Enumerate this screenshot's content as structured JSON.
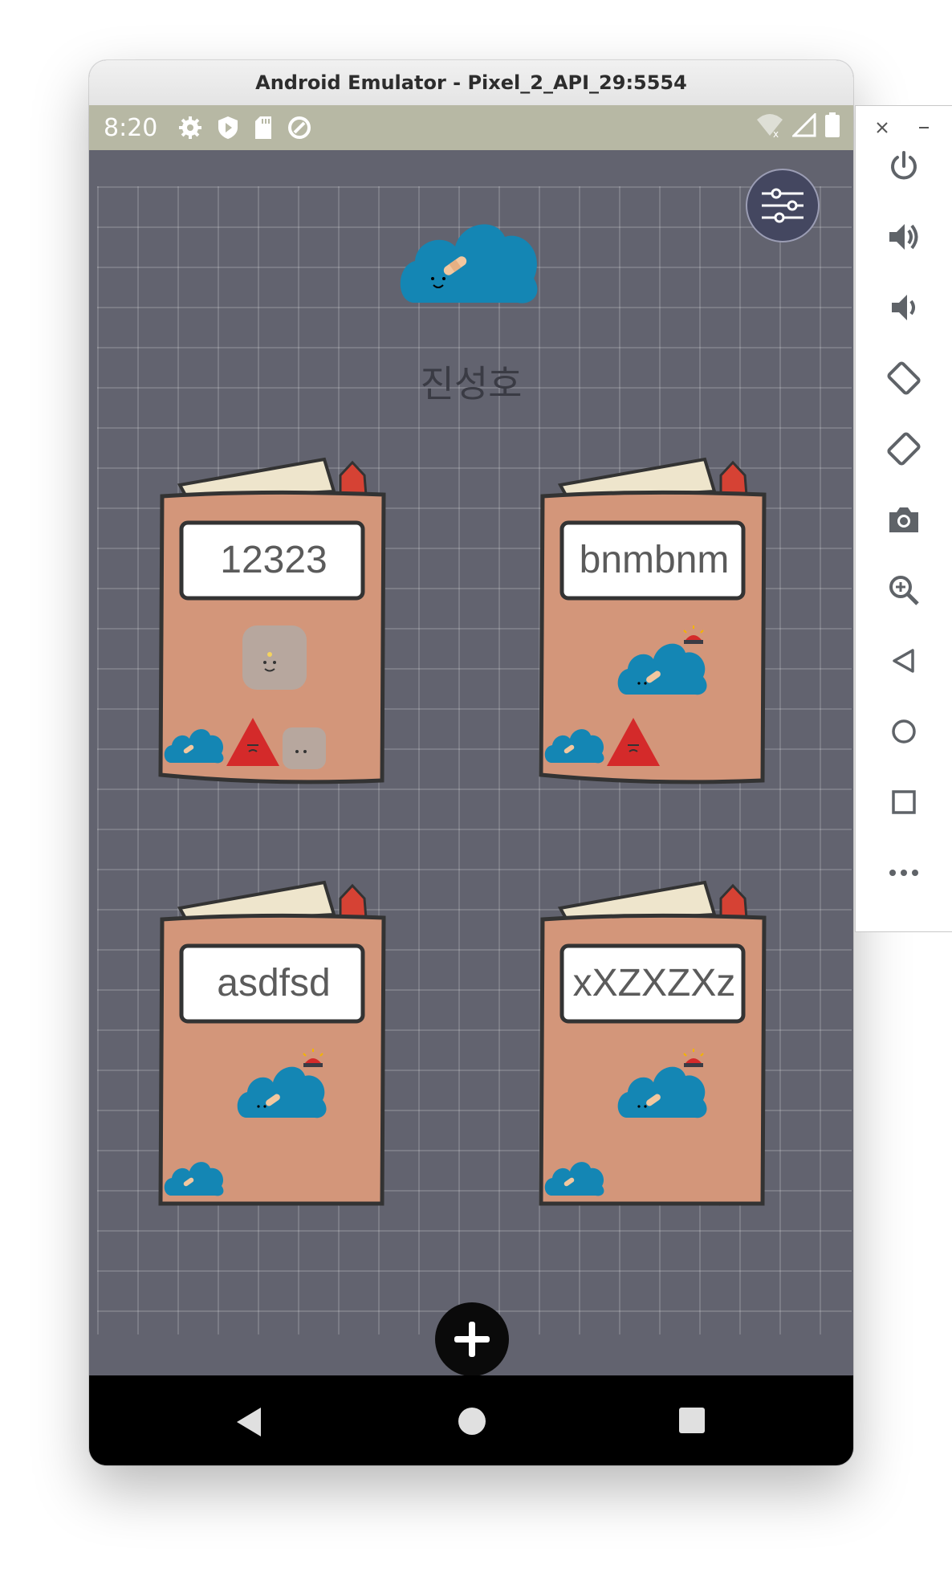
{
  "window": {
    "title": "Android Emulator - Pixel_2_API_29:5554"
  },
  "status_bar": {
    "time": "8:20",
    "left_icons": [
      "gear-icon",
      "play-protect-icon",
      "sd-card-icon",
      "sync-icon"
    ],
    "right_icons": [
      "wifi-icon",
      "signal-icon",
      "battery-icon"
    ]
  },
  "app": {
    "user_name": "진성호",
    "colors": {
      "background": "#62636f",
      "book_cover": "#d3967a",
      "book_pages": "#eee5cc",
      "bookmark": "#d64234",
      "cloud": "#1486b4",
      "settings_button": "#444760"
    },
    "notebooks": [
      {
        "label": "12323",
        "stickers": [
          "gray-blob-icon",
          "cloud-icon",
          "red-triangle-icon",
          "gray-blob-icon"
        ]
      },
      {
        "label": "bnmbnm",
        "stickers": [
          "siren-cloud-icon",
          "cloud-icon",
          "red-triangle-icon"
        ]
      },
      {
        "label": "asdfsd",
        "stickers": [
          "siren-cloud-icon",
          "cloud-icon"
        ]
      },
      {
        "label": "xXZXZXz",
        "stickers": [
          "siren-cloud-icon",
          "cloud-icon"
        ]
      }
    ],
    "add_button_icon": "plus-icon",
    "settings_icon": "sliders-icon"
  },
  "navigation": {
    "buttons": [
      "back-icon",
      "home-icon",
      "recents-icon"
    ]
  },
  "side_toolbar": {
    "window_controls": [
      "close-icon",
      "minimize-icon"
    ],
    "buttons": [
      "power-icon",
      "volume-up-icon",
      "volume-down-icon",
      "rotate-left-icon",
      "rotate-right-icon",
      "camera-icon",
      "zoom-icon",
      "back-icon",
      "home-icon",
      "overview-icon",
      "more-icon"
    ]
  }
}
